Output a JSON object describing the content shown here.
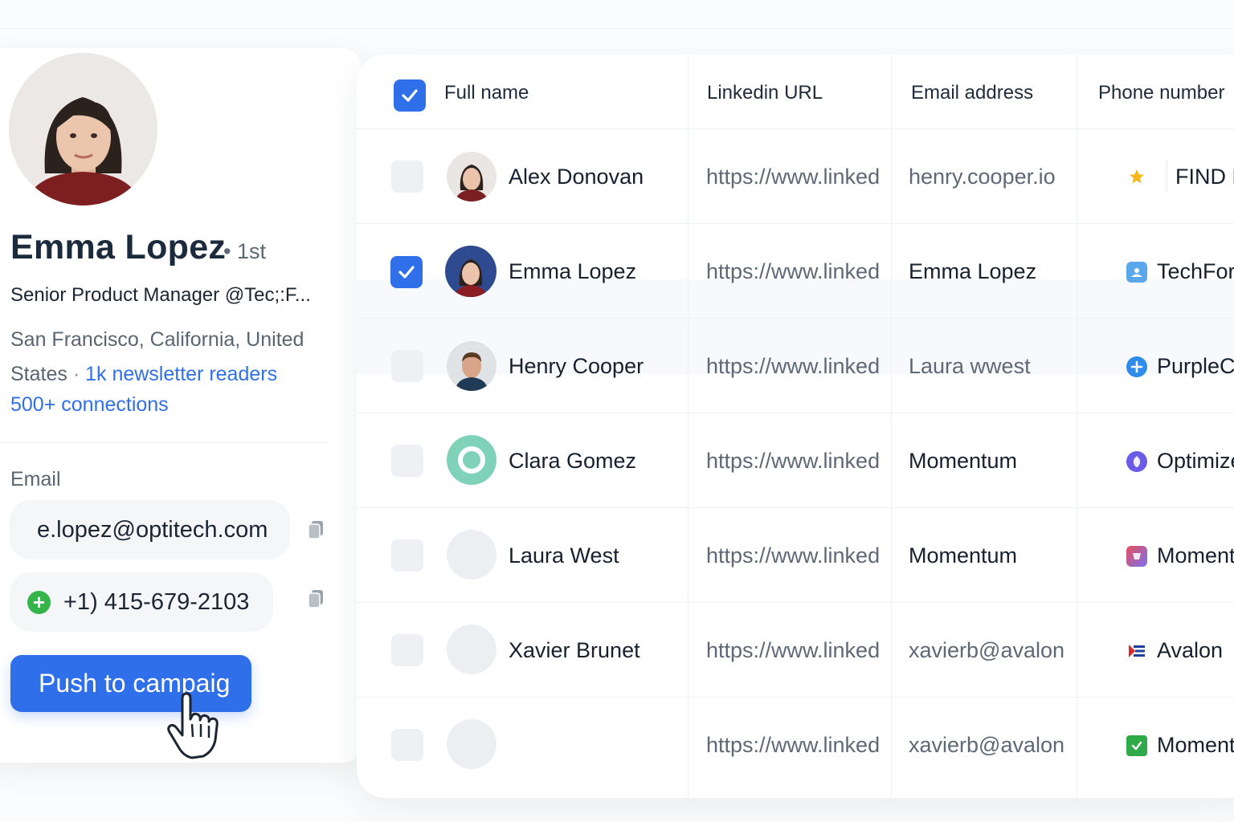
{
  "profile": {
    "name": "Emma Lopez",
    "degree": "• 1st",
    "headline": "Senior Product Manager @Tec;:F...",
    "location": "San Francisco, California, United States",
    "location_separator": " · ",
    "newsletter": "1k newsletter readers",
    "connections": "500+ connections",
    "email_label": "Email",
    "email": "e.lopez@optitech.com",
    "phone": "+1) 415-679-2103",
    "push_button": "Push to campaig"
  },
  "table": {
    "headers": {
      "full_name": "Full name",
      "linkedin_url": "Linkedin URL",
      "email_address": "Email address",
      "phone_number": "Phone number"
    },
    "rows": [
      {
        "checked": false,
        "name": "Alex Donovan",
        "url": "https://www.linked",
        "email": "henry.cooper.io",
        "company": "FIND EMO",
        "company_icon": "star-icon"
      },
      {
        "checked": true,
        "name": "Emma Lopez",
        "url": "https://www.linked",
        "email": "Emma Lopez",
        "company": "TechForwa",
        "company_icon": "image-icon"
      },
      {
        "checked": false,
        "name": "Henry Cooper",
        "url": "https://www.linked",
        "email": "Laura wwest",
        "company": "PurpleCo",
        "company_icon": "plus-circle-icon"
      },
      {
        "checked": false,
        "name": "Clara Gomez",
        "url": "https://www.linked",
        "email": "Momentum",
        "company": "OptimizelO",
        "company_icon": "purple-shield-icon"
      },
      {
        "checked": false,
        "name": "Laura West",
        "url": "https://www.linked",
        "email": "Momentum",
        "company": "Momentum",
        "company_icon": "gradient-logo-icon"
      },
      {
        "checked": false,
        "name": "Xavier Brunet",
        "url": "https://www.linked",
        "email": "xavierb@avalon",
        "company": "Avalon",
        "company_icon": "flag-logo-icon"
      },
      {
        "checked": false,
        "name": "",
        "url": "https://www.linked",
        "email": "xavierb@avalon",
        "company": "Momentum",
        "company_icon": "green-check-icon"
      }
    ]
  },
  "colors": {
    "accent": "#2f6fea",
    "text_dark": "#16202e",
    "text_muted": "#5e6876",
    "green": "#35b44a"
  }
}
